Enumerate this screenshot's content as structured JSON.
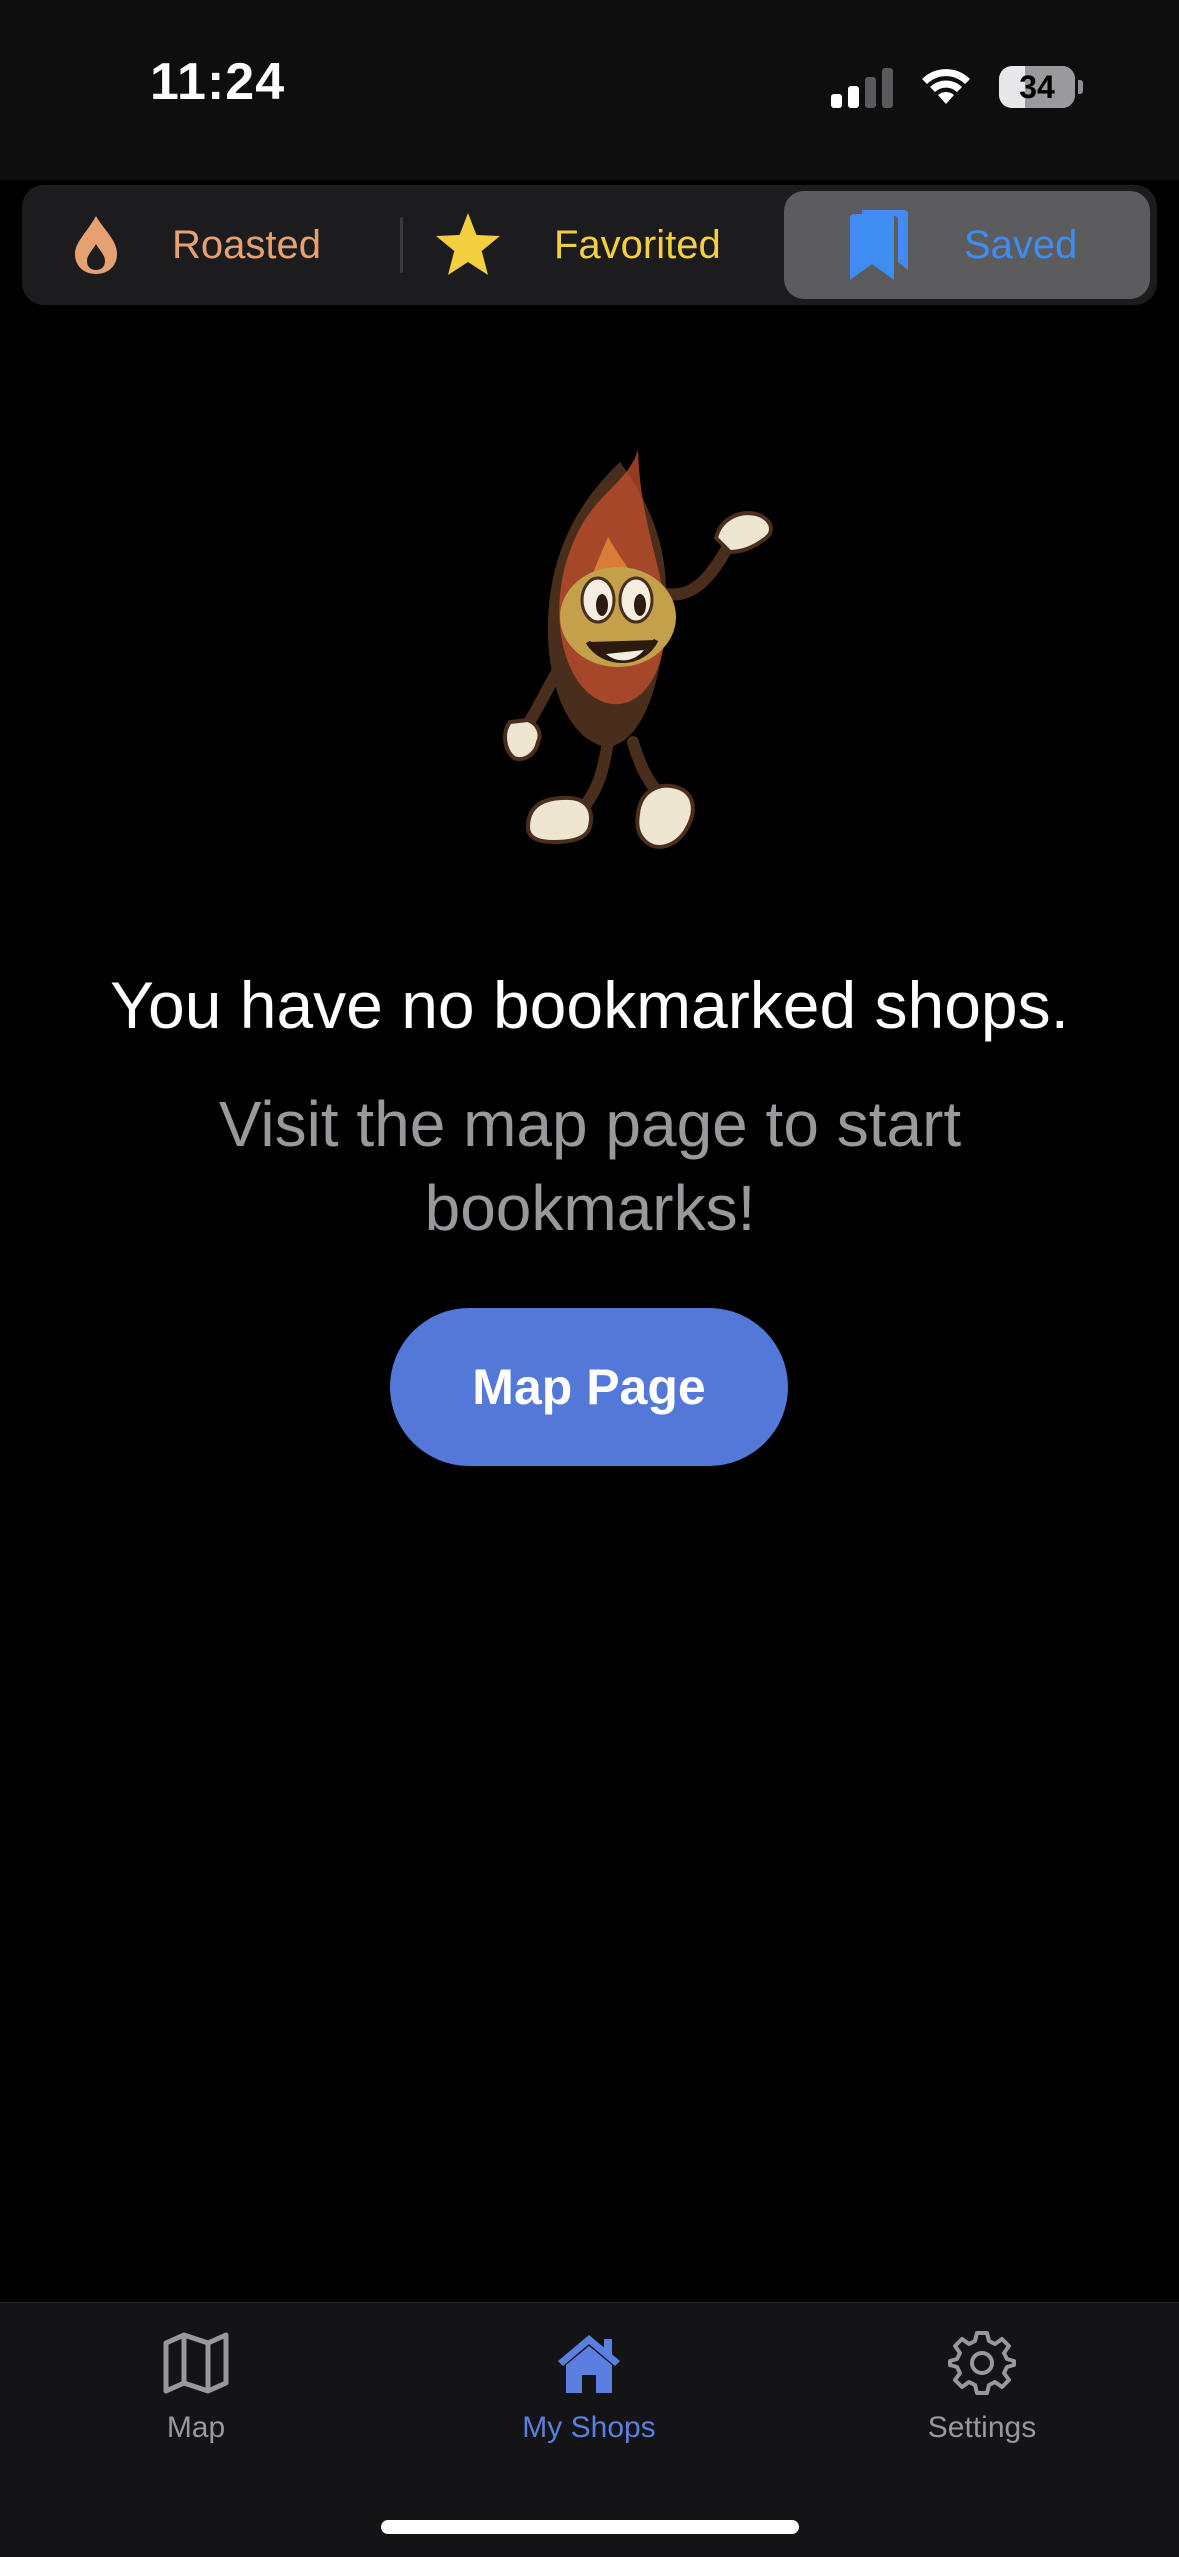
{
  "status_bar": {
    "time": "11:24",
    "battery_level": "34",
    "signal_bars_active": 2,
    "signal_bars_total": 4
  },
  "filter_tabs": [
    {
      "label": "Roasted",
      "icon": "flame-icon",
      "color": "#e6a173",
      "selected": false
    },
    {
      "label": "Favorited",
      "icon": "star-icon",
      "color": "#f4cf3f",
      "selected": false
    },
    {
      "label": "Saved",
      "icon": "bookmark-icon",
      "color": "#3f8cf2",
      "selected": true
    }
  ],
  "empty_state": {
    "mascot": "coffee-bean-mascot",
    "title": "You have no bookmarked shops.",
    "subtitle": "Visit the map page to start bookmarks!",
    "button_label": "Map Page",
    "button_color": "#5478d8"
  },
  "tab_bar": {
    "items": [
      {
        "label": "Map",
        "icon": "map-icon",
        "active": false
      },
      {
        "label": "My Shops",
        "icon": "home-icon",
        "active": true
      },
      {
        "label": "Settings",
        "icon": "gear-icon",
        "active": false
      }
    ],
    "active_color": "#5a7fe0",
    "inactive_color": "#98989d"
  }
}
